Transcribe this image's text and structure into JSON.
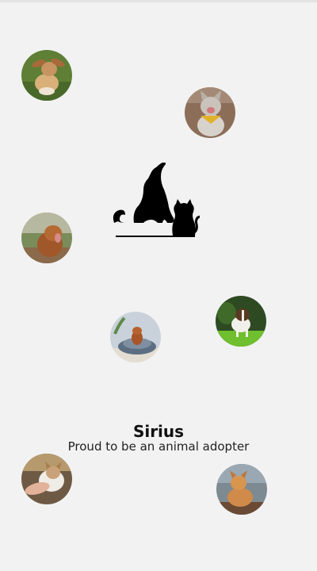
{
  "profile": {
    "name": "Sirius",
    "tagline": "Proud to be an animal adopter"
  },
  "logo": {
    "icon": "dog-and-cat-silhouette-icon",
    "color": "#000000"
  },
  "photos": [
    {
      "icon": "dog-on-grass-photo",
      "accent": "#c68a4a"
    },
    {
      "icon": "cat-yellow-bandana-photo",
      "accent": "#8a6a50"
    },
    {
      "icon": "brown-dog-outdoors-photo",
      "accent": "#9a5a2e"
    },
    {
      "icon": "border-collie-on-lawn-photo",
      "accent": "#4c8a2a"
    },
    {
      "icon": "puppy-in-bed-photo",
      "accent": "#7a8a98"
    },
    {
      "icon": "cat-held-in-hand-photo",
      "accent": "#b07a4e"
    },
    {
      "icon": "orange-cat-photo",
      "accent": "#c07840"
    }
  ]
}
